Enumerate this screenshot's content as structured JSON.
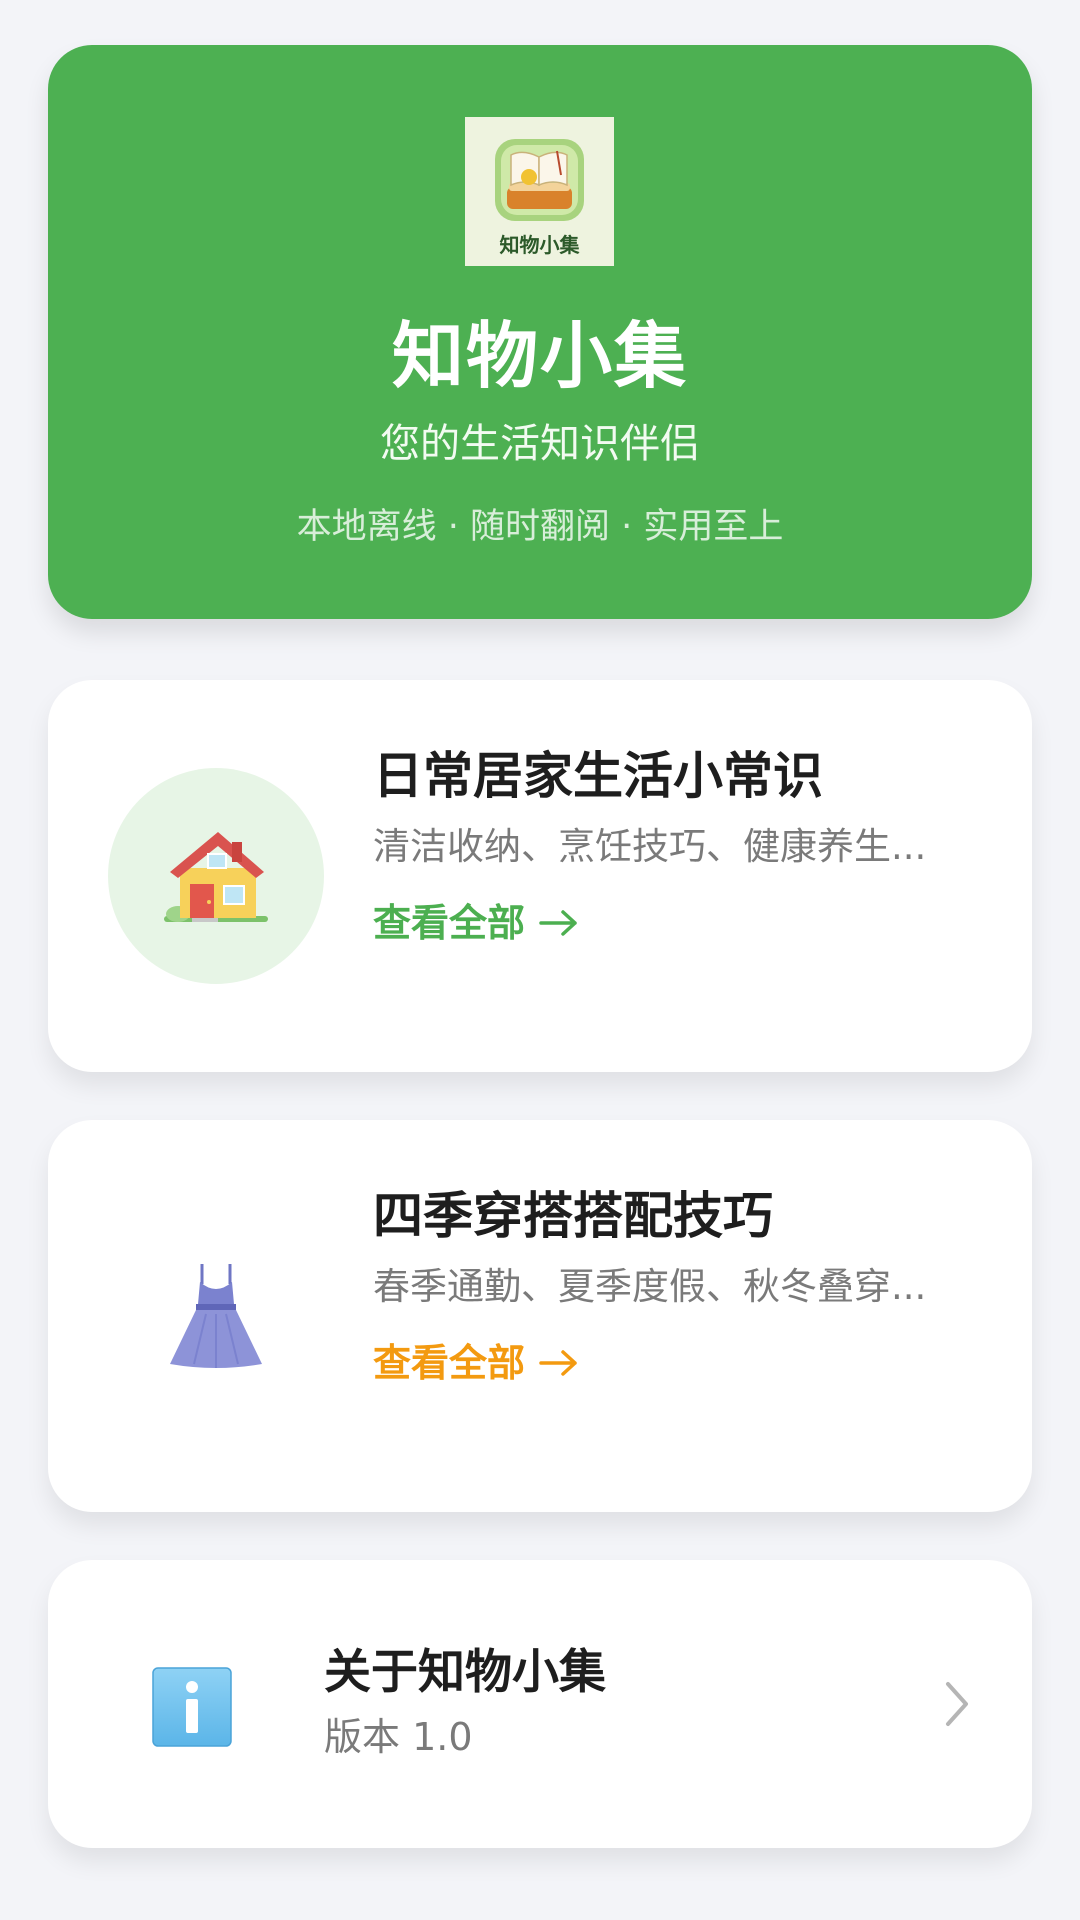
{
  "hero": {
    "logo_text": "知物小集",
    "title": "知物小集",
    "subtitle": "您的生活知识伴侣",
    "tagline": "本地离线 · 随时翻阅 · 实用至上",
    "background_color": "#4db052"
  },
  "categories": [
    {
      "icon": "house-icon",
      "title": "日常居家生活小常识",
      "description": "清洁收纳、烹饪技巧、健康养生...",
      "link_label": "查看全部",
      "accent_color": "#4caf50"
    },
    {
      "icon": "dress-icon",
      "title": "四季穿搭搭配技巧",
      "description": "春季通勤、夏季度假、秋冬叠穿...",
      "link_label": "查看全部",
      "accent_color": "#f39a10"
    }
  ],
  "about": {
    "icon": "info-icon",
    "title": "关于知物小集",
    "version": "版本 1.0"
  }
}
